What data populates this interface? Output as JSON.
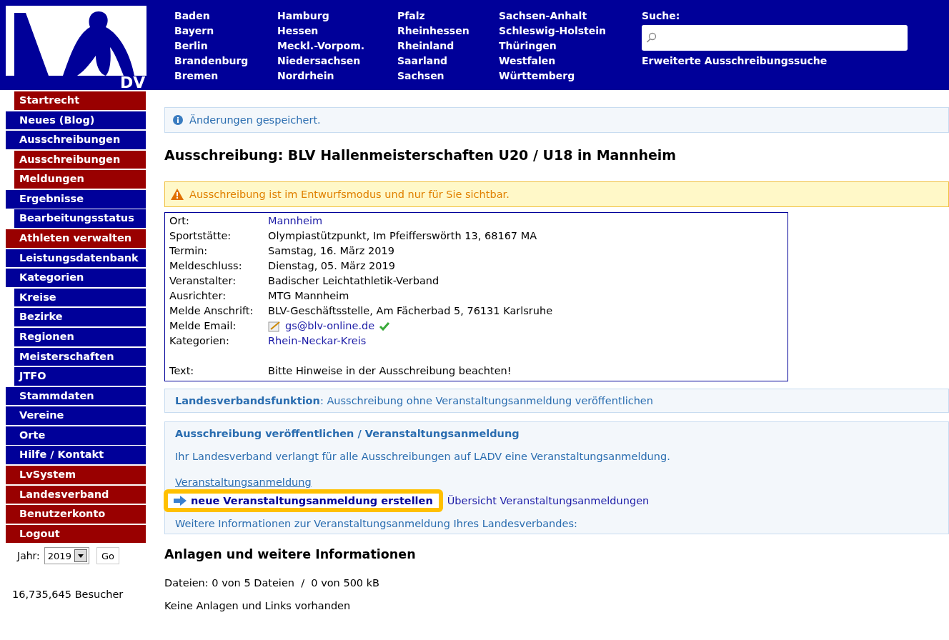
{
  "logo": {
    "text": "DV"
  },
  "regions": [
    [
      "Baden",
      "Bayern",
      "Berlin",
      "Brandenburg",
      "Bremen"
    ],
    [
      "Hamburg",
      "Hessen",
      "Meckl.-Vorpom.",
      "Niedersachsen",
      "Nordrhein"
    ],
    [
      "Pfalz",
      "Rheinhessen",
      "Rheinland",
      "Saarland",
      "Sachsen"
    ],
    [
      "Sachsen-Anhalt",
      "Schleswig-Holstein",
      "Thüringen",
      "Westfalen",
      "Württemberg"
    ]
  ],
  "search": {
    "label": "Suche:",
    "link": "Erweiterte Ausschreibungssuche"
  },
  "sidebar": {
    "items": [
      {
        "label": "Startrecht",
        "color": "#990000",
        "kind": "sub"
      },
      {
        "label": "Neues (Blog)",
        "color": "#000099",
        "kind": "main"
      },
      {
        "label": "Ausschreibungen",
        "color": "#000099",
        "kind": "main",
        "children": [
          {
            "label": "Ausschreibungen",
            "color": "#990000"
          },
          {
            "label": "Meldungen",
            "color": "#990000"
          }
        ]
      },
      {
        "label": "Ergebnisse",
        "color": "#000099",
        "kind": "main",
        "children": [
          {
            "label": "Bearbeitungsstatus",
            "color": "#000099"
          }
        ]
      },
      {
        "label": "Athleten verwalten",
        "color": "#990000",
        "kind": "main"
      },
      {
        "label": "Leistungsdatenbank",
        "color": "#000099",
        "kind": "main"
      },
      {
        "label": "Kategorien",
        "color": "#000099",
        "kind": "main",
        "children": [
          {
            "label": "Kreise",
            "color": "#000099"
          },
          {
            "label": "Bezirke",
            "color": "#000099"
          },
          {
            "label": "Regionen",
            "color": "#000099"
          },
          {
            "label": "Meisterschaften",
            "color": "#000099"
          },
          {
            "label": "JTFO",
            "color": "#000099"
          }
        ]
      },
      {
        "label": "Stammdaten",
        "color": "#000099",
        "kind": "main"
      },
      {
        "label": "Vereine",
        "color": "#000099",
        "kind": "main"
      },
      {
        "label": "Orte",
        "color": "#000099",
        "kind": "main"
      },
      {
        "label": "Hilfe / Kontakt",
        "color": "#000099",
        "kind": "main"
      },
      {
        "label": "LvSystem",
        "color": "#990000",
        "kind": "main"
      },
      {
        "label": "Landesverband",
        "color": "#990000",
        "kind": "main"
      },
      {
        "label": "Benutzerkonto",
        "color": "#990000",
        "kind": "main"
      },
      {
        "label": "Logout",
        "color": "#990000",
        "kind": "main"
      }
    ],
    "year": {
      "label": "Jahr:",
      "value": "2019",
      "button": "Go"
    },
    "visitors": "16,735,645 Besucher"
  },
  "info": "Änderungen gespeichert.",
  "title": "Ausschreibung: BLV Hallenmeisterschaften U20 / U18 in Mannheim",
  "warning": "Ausschreibung ist im Entwurfsmodus und nur für Sie sichtbar.",
  "details": [
    {
      "label": "Ort:",
      "value": "Mannheim",
      "kind": "link"
    },
    {
      "label": "Sportstätte:",
      "value": "Olympiastützpunkt, Im Pfeifferswörth 13, 68167 MA",
      "kind": "text"
    },
    {
      "label": "Termin:",
      "value": "Samstag, 16. März 2019",
      "kind": "text"
    },
    {
      "label": "Meldeschluss:",
      "value": "Dienstag, 05. März 2019",
      "kind": "text"
    },
    {
      "label": "Veranstalter:",
      "value": "Badischer Leichtathletik-Verband",
      "kind": "text"
    },
    {
      "label": "Ausrichter:",
      "value": "MTG Mannheim",
      "kind": "text"
    },
    {
      "label": "Melde Anschrift:",
      "value": "BLV-Geschäftsstelle, Am Fächerbad 5, 76131 Karlsruhe",
      "kind": "text"
    },
    {
      "label": "Melde Email:",
      "value": "gs@blv-online.de",
      "kind": "email"
    },
    {
      "label": "Kategorien:",
      "value": "Rhein-Neckar-Kreis",
      "kind": "link"
    },
    {
      "label": "Text:",
      "value": "Bitte Hinweise in der Ausschreibung beachten!",
      "kind": "note"
    }
  ],
  "lv_function": {
    "label": "Landesverbandsfunktion",
    "text": ": Ausschreibung ohne Veranstaltungsanmeldung veröffentlichen"
  },
  "publish": {
    "heading": "Ausschreibung veröffentlichen / Veranstaltungsanmeldung",
    "text": "Ihr Landesverband verlangt für alle Ausschreibungen auf LADV eine Veranstaltungsanmeldung.",
    "link": "Veranstaltungsanmeldung",
    "create": "neue Veranstaltungsanmeldung erstellen",
    "overview": "Übersicht Veranstaltungsanmeldungen",
    "more": "Weitere Informationen zur Veranstaltungsanmeldung Ihres Landesverbandes:"
  },
  "attachments": {
    "heading": "Anlagen und weitere Informationen",
    "files": "Dateien: 0 von 5 Dateien  /  0 von 500 kB",
    "none": "Keine Anlagen und Links vorhanden"
  }
}
